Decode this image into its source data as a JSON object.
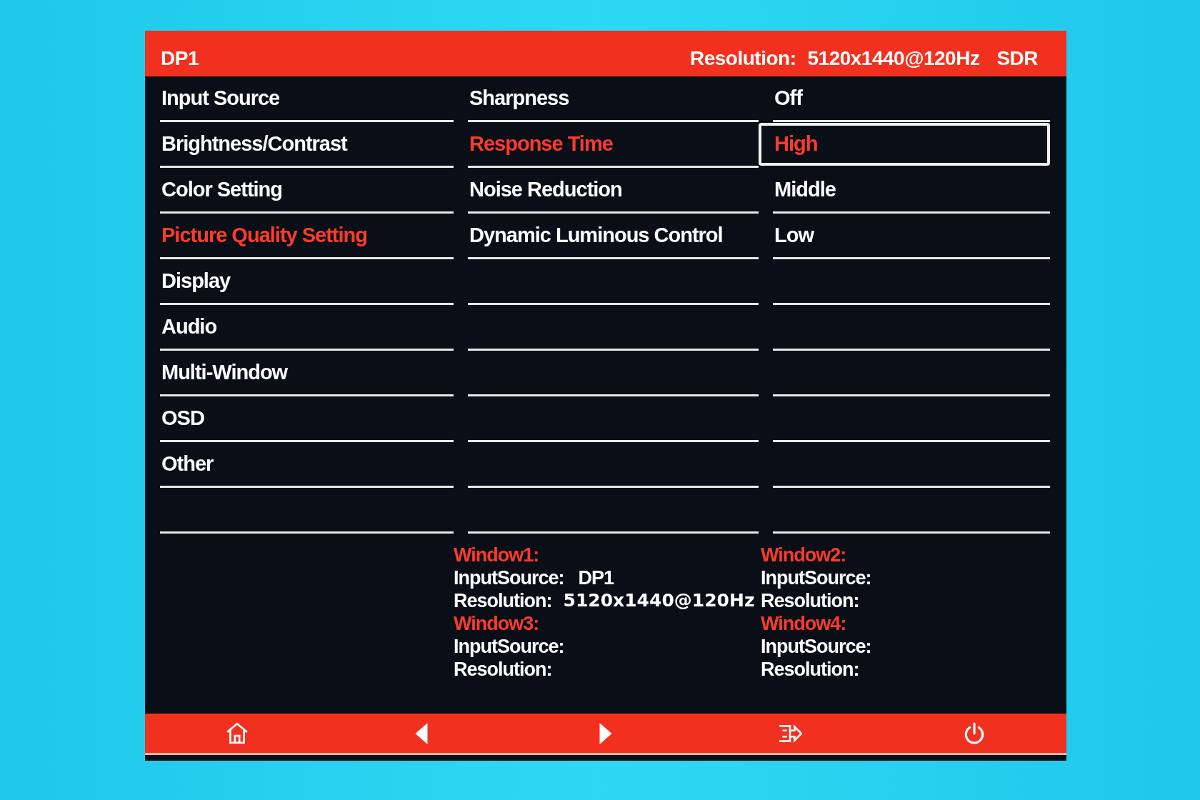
{
  "header": {
    "input_name": "DP1",
    "resolution_label": "Resolution:",
    "resolution_value": "5120x1440@120Hz",
    "range": "SDR"
  },
  "menu": [
    {
      "label": "Input Source",
      "selected": false
    },
    {
      "label": "Brightness/Contrast",
      "selected": false
    },
    {
      "label": "Color Setting",
      "selected": false
    },
    {
      "label": "Picture Quality Setting",
      "selected": true
    },
    {
      "label": "Display",
      "selected": false
    },
    {
      "label": "Audio",
      "selected": false
    },
    {
      "label": "Multi-Window",
      "selected": false
    },
    {
      "label": "OSD",
      "selected": false
    },
    {
      "label": "Other",
      "selected": false
    }
  ],
  "submenu": [
    {
      "label": "Sharpness",
      "selected": false
    },
    {
      "label": "Response Time",
      "selected": true
    },
    {
      "label": "Noise Reduction",
      "selected": false
    },
    {
      "label": "Dynamic Luminous Control",
      "selected": false
    }
  ],
  "options": [
    {
      "label": "Off",
      "selected": false
    },
    {
      "label": "High",
      "selected": true
    },
    {
      "label": "Middle",
      "selected": false
    },
    {
      "label": "Low",
      "selected": false
    }
  ],
  "windows": [
    {
      "title": "Window1:",
      "input_label": "InputSource:",
      "input_value": "DP1",
      "resolution_label": "Resolution:",
      "resolution_value": "5120x1440@120Hz"
    },
    {
      "title": "Window2:",
      "input_label": "InputSource:",
      "resolution_label": "Resolution:"
    },
    {
      "title": "Window3:",
      "input_label": "InputSource:",
      "resolution_label": "Resolution:"
    },
    {
      "title": "Window4:",
      "input_label": "InputSource:",
      "resolution_label": "Resolution:"
    }
  ],
  "footer": [
    {
      "kind": "home"
    },
    {
      "kind": "left"
    },
    {
      "kind": "right"
    },
    {
      "kind": "exit"
    },
    {
      "kind": "power"
    }
  ]
}
